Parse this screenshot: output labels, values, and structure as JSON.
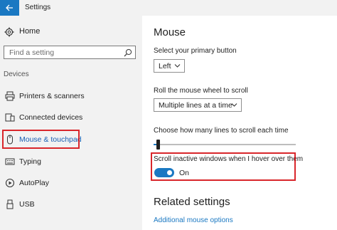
{
  "window": {
    "title": "Settings"
  },
  "sidebar": {
    "home_label": "Home",
    "search_placeholder": "Find a setting",
    "section_label": "Devices",
    "items": [
      {
        "label": "Printers & scanners",
        "icon": "printer-icon"
      },
      {
        "label": "Connected devices",
        "icon": "connected-devices-icon"
      },
      {
        "label": "Mouse & touchpad",
        "icon": "mouse-icon",
        "selected": true
      },
      {
        "label": "Typing",
        "icon": "keyboard-icon"
      },
      {
        "label": "AutoPlay",
        "icon": "autoplay-icon"
      },
      {
        "label": "USB",
        "icon": "usb-icon"
      }
    ]
  },
  "main": {
    "title": "Mouse",
    "primary_button_label": "Select your primary button",
    "primary_button_value": "Left",
    "scroll_label": "Roll the mouse wheel to scroll",
    "scroll_value": "Multiple lines at a time",
    "lines_label": "Choose how many lines to scroll each time",
    "lines_slider_fraction": 0.03,
    "inactive_scroll_label": "Scroll inactive windows when I hover over them",
    "inactive_scroll_state": "On",
    "related_title": "Related settings",
    "related_link": "Additional mouse options"
  },
  "colors": {
    "accent": "#1a78c2",
    "highlight_box": "#d9262b",
    "sidebar_bg": "#f2f2f2"
  }
}
